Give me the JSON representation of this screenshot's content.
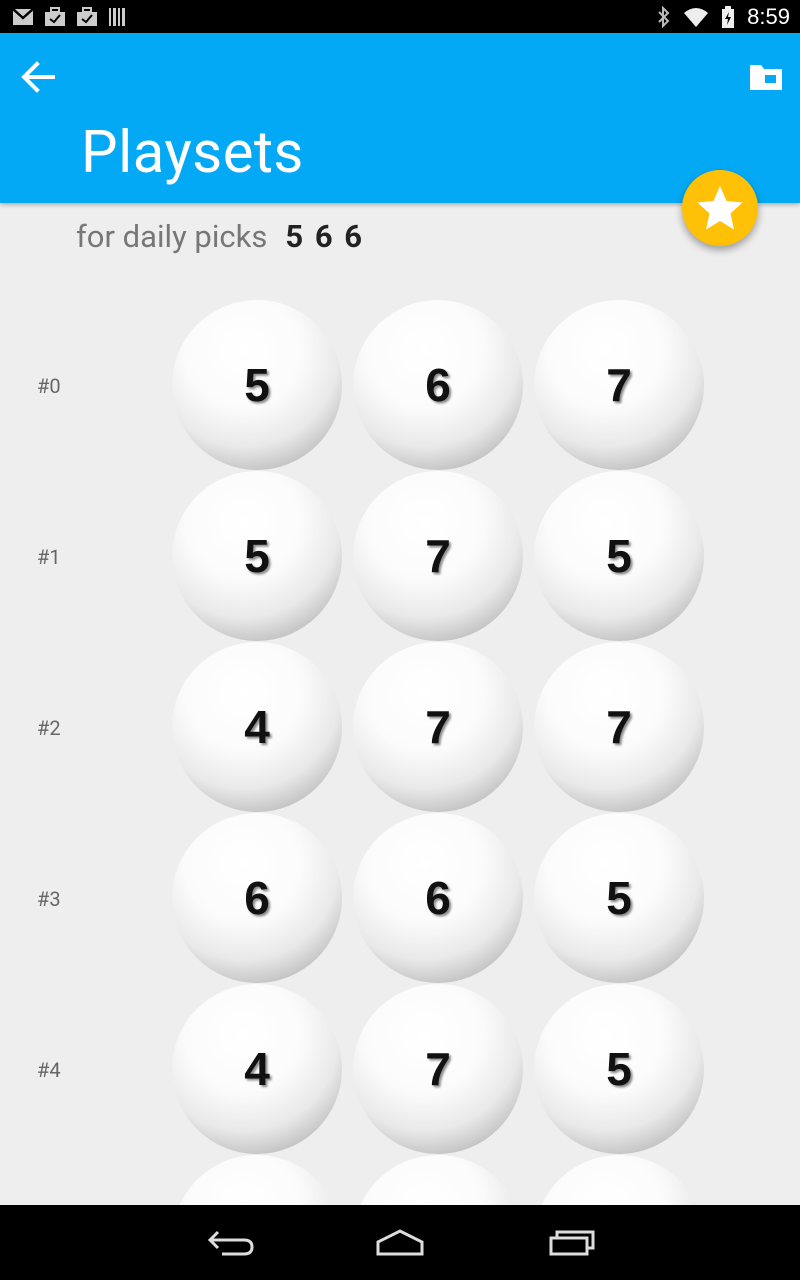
{
  "status_bar": {
    "time": "8:59",
    "left_icons": [
      "gmail-icon",
      "briefcase-check-icon",
      "briefcase-check-icon",
      "barcode-icon"
    ],
    "right_icons": [
      "bluetooth-icon",
      "wifi-icon",
      "battery-charging-icon"
    ]
  },
  "app_bar": {
    "title": "Playsets",
    "back_icon": "arrow-left-icon",
    "action_icon": "folder-icon",
    "background": "#03a9f4"
  },
  "fab": {
    "icon": "star-icon",
    "color": "#ffc107"
  },
  "subtitle": {
    "label": "for daily picks",
    "picks": "5 6 6"
  },
  "playsets": [
    {
      "label": "#0",
      "balls": [
        "5",
        "6",
        "7"
      ]
    },
    {
      "label": "#1",
      "balls": [
        "5",
        "7",
        "5"
      ]
    },
    {
      "label": "#2",
      "balls": [
        "4",
        "7",
        "7"
      ]
    },
    {
      "label": "#3",
      "balls": [
        "6",
        "6",
        "5"
      ]
    },
    {
      "label": "#4",
      "balls": [
        "4",
        "7",
        "5"
      ]
    },
    {
      "label": "",
      "balls": [
        "",
        "",
        ""
      ]
    }
  ],
  "nav_bar": {
    "buttons": [
      "back-icon",
      "home-icon",
      "recents-icon"
    ]
  }
}
